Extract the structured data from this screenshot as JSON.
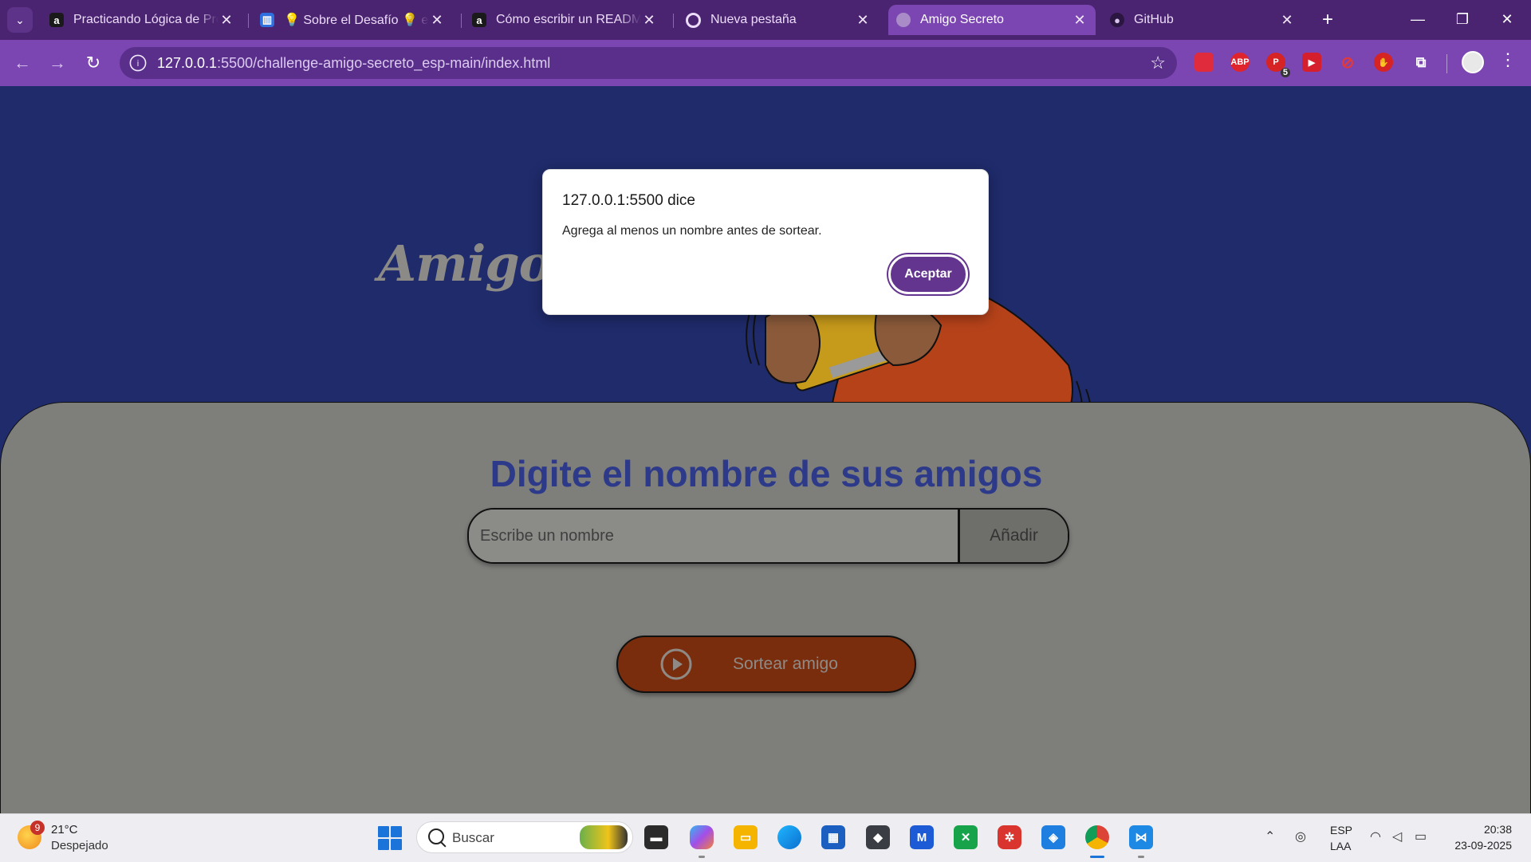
{
  "browser": {
    "tabs": [
      {
        "label": "Practicando Lógica de Programación",
        "favicon": "a"
      },
      {
        "label": "💡 Sobre el Desafío 💡 en Trello",
        "favicon": "trello"
      },
      {
        "label": "Cómo escribir un README",
        "favicon": "a"
      },
      {
        "label": "Nueva pestaña",
        "favicon": "chrome"
      },
      {
        "label": "Amigo Secreto",
        "favicon": "globe",
        "active": true
      },
      {
        "label": "GitHub",
        "favicon": "github"
      }
    ],
    "url_host": "127.0.0.1",
    "url_rest": ":5500/challenge-amigo-secreto_esp-main/index.html",
    "extensions": [
      {
        "name": "pocket-extension-icon",
        "label": "",
        "color": "#e02b3c"
      },
      {
        "name": "adblock-plus-extension-icon",
        "label": "ABP",
        "color": "#e0242c"
      },
      {
        "name": "extension-red-badge-icon",
        "label": "P",
        "color": "#d62424",
        "badge": "5"
      },
      {
        "name": "extension-play-icon",
        "label": "▶",
        "color": "#d61f2c"
      },
      {
        "name": "blocked-extension-icon",
        "label": "⊘",
        "color": "#7b45b2"
      },
      {
        "name": "hand-stop-extension-icon",
        "label": "✋",
        "color": "#d62424"
      }
    ]
  },
  "page": {
    "banner_title": "Amigo Secreto",
    "section_title": "Digite el nombre de sus amigos",
    "input_placeholder": "Escribe un nombre",
    "add_button": "Añadir",
    "draw_button": "Sortear amigo"
  },
  "dialog": {
    "title": "127.0.0.1:5500 dice",
    "message": "Agrega al menos un nombre antes de sortear.",
    "ok_button": "Aceptar"
  },
  "taskbar": {
    "weather_badge": "9",
    "temperature": "21°C",
    "condition": "Despejado",
    "search_label": "Buscar",
    "language_line1": "ESP",
    "language_line2": "LAA",
    "time": "20:38",
    "date": "23-09-2025"
  }
}
